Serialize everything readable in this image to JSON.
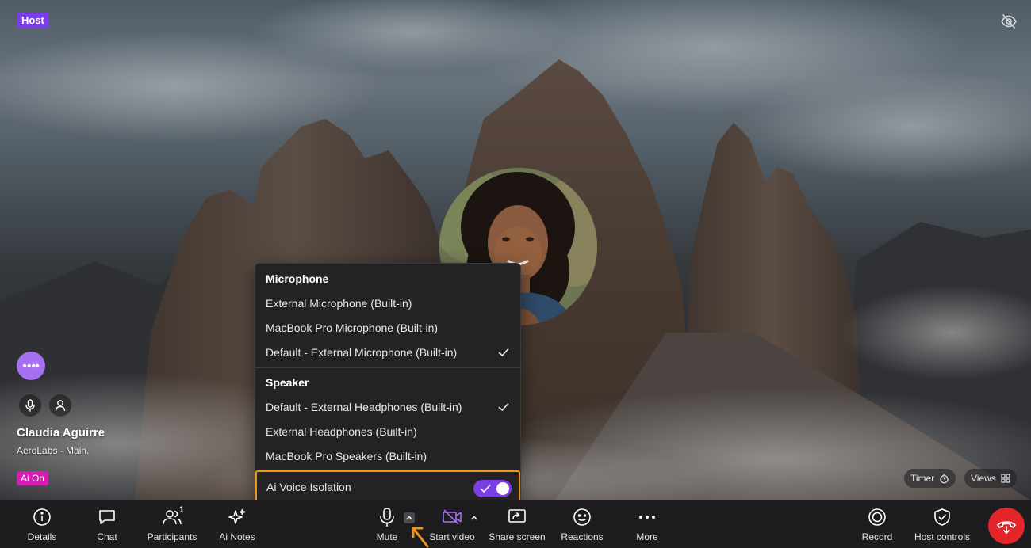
{
  "top": {
    "host_badge": "Host",
    "icons": [
      "eye-off-icon"
    ]
  },
  "participant": {
    "name": "Claudia Aguirre",
    "org": "AeroLabs - Main.",
    "ai_badge": "Ai On",
    "icons": [
      "more-dots-icon",
      "microphone-icon",
      "person-icon"
    ]
  },
  "chips": {
    "timer": "Timer",
    "views": "Views"
  },
  "audio_menu": {
    "microphone_heading": "Microphone",
    "microphones": [
      {
        "label": "External Microphone (Built-in)",
        "selected": false
      },
      {
        "label": "MacBook Pro Microphone (Built-in)",
        "selected": false
      },
      {
        "label": "Default - External Microphone (Built-in)",
        "selected": true
      }
    ],
    "speaker_heading": "Speaker",
    "speakers": [
      {
        "label": "Default - External Headphones (Built-in)",
        "selected": true
      },
      {
        "label": "External Headphones (Built-in)",
        "selected": false
      },
      {
        "label": "MacBook Pro Speakers (Built-in)",
        "selected": false
      }
    ],
    "voice_isolation": {
      "label": "Ai Voice Isolation",
      "enabled": true
    }
  },
  "toolbar": {
    "details": "Details",
    "chat": "Chat",
    "participants": "Participants",
    "participants_count": "1",
    "ai_notes": "Ai Notes",
    "mute": "Mute",
    "start_video": "Start video",
    "share_screen": "Share screen",
    "reactions": "Reactions",
    "more": "More",
    "record": "Record",
    "host_controls": "Host controls"
  },
  "colors": {
    "accent_purple": "#7a3fe4",
    "ai_badge": "#d31db3",
    "end_call": "#e4262b",
    "highlight_orange": "#f0951b",
    "video_off": "#a56ff2"
  }
}
